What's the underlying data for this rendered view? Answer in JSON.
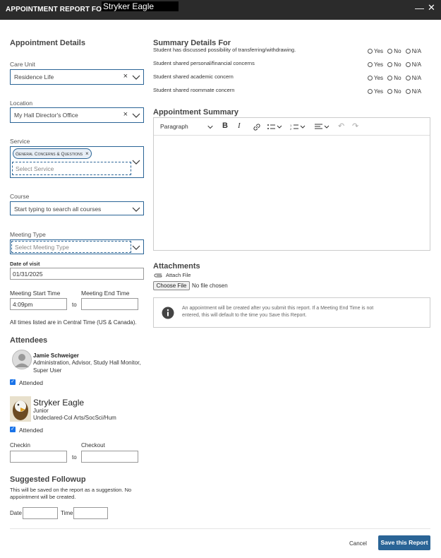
{
  "window": {
    "title_prefix": "APPOINTMENT REPORT FOR",
    "title_student": "Stryker Eagle",
    "minimize_glyph": "—",
    "close_glyph": "✕"
  },
  "left": {
    "section_title": "Appointment Details",
    "care_unit": {
      "label": "Care Unit",
      "value": "Residence Life"
    },
    "location": {
      "label": "Location",
      "value": "My Hall Director's Office"
    },
    "service": {
      "label": "Service",
      "chip": "General Concerns & Questions",
      "placeholder": "Select Service"
    },
    "course": {
      "label": "Course",
      "placeholder": "Start typing to search all courses"
    },
    "meeting_type": {
      "label": "Meeting Type",
      "placeholder": "Select Meeting Type"
    },
    "date_of_visit": {
      "label": "Date of visit",
      "value": "01/31/2025"
    },
    "meeting_start": {
      "label": "Meeting Start Time",
      "value": "4:09pm"
    },
    "meeting_end": {
      "label": "Meeting End Time",
      "value": ""
    },
    "to": "to",
    "timezone_note": "All times listed are in Central Time (US & Canada).",
    "attendees_title": "Attendees",
    "attendee1": {
      "name": "Jamie Schweiger",
      "role_line1": "Administration, Advisor, Study Hall Monitor,",
      "role_line2": "Super User",
      "attended": "Attended"
    },
    "attendee2": {
      "name": "Stryker Eagle",
      "role_line1": "Junior",
      "role_line2": "Undeclared-Col Arts/SocSci/Hum",
      "attended": "Attended"
    },
    "checkin_label": "Checkin",
    "checkout_label": "Checkout",
    "followup_title": "Suggested Followup",
    "followup_note_line1": "This will be saved on the report as a suggestion. No",
    "followup_note_line2": "appointment will be created.",
    "date_label": "Date",
    "time_label": "Time"
  },
  "right": {
    "summary_title": "Summary Details For",
    "questions": [
      {
        "text": "Student has discussed possibility of transferring/withdrawing."
      },
      {
        "text": "Student shared personal/financial concerns"
      },
      {
        "text": "Student shared academic concern"
      },
      {
        "text": "Student shared roommate concern"
      }
    ],
    "opt_yes": "Yes",
    "opt_no": "No",
    "opt_na": "N/A",
    "appt_summary_title": "Appointment Summary",
    "editor_format": "Paragraph",
    "attachments_title": "Attachments",
    "attach_file": "Attach File",
    "choose_file": "Choose File",
    "no_file": "No file chosen",
    "info_line1": "An appointment will be created after you submit this report. If a Meeting End Time is not",
    "info_line2": "entered, this will default to the time you Save this Report."
  },
  "footer": {
    "cancel": "Cancel",
    "save": "Save this Report"
  },
  "colors": {
    "accent": "#2a6496",
    "titlebar": "#2b2b2b",
    "checkbox": "#1a73e8"
  }
}
